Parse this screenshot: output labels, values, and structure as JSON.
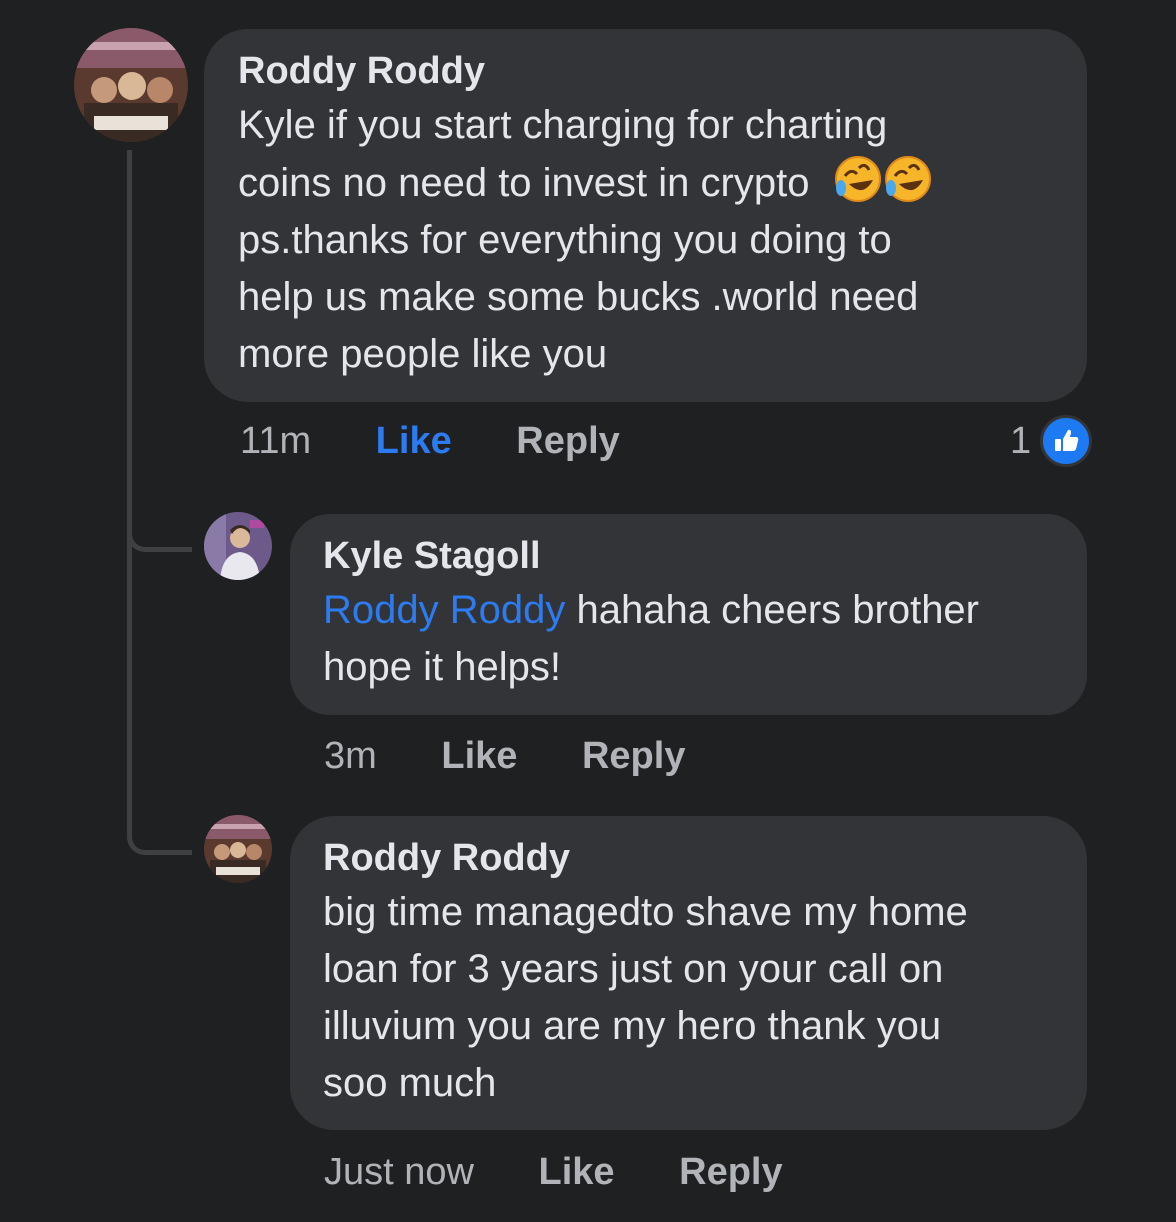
{
  "comments": [
    {
      "author": "Roddy Roddy",
      "text_lines": [
        "Kyle if you start charging for charting",
        "coins no need to invest in crypto",
        "ps.thanks for everything you doing to",
        "help us make some bucks .world need",
        "more people like you"
      ],
      "emoji": [
        "rolling-on-floor-laughing-emoji",
        "rolling-on-floor-laughing-emoji"
      ],
      "time": "11m",
      "like_label": "Like",
      "reply_label": "Reply",
      "reaction_count": "1",
      "reaction_icon": "thumbs-up-icon"
    },
    {
      "author": "Kyle Stagoll",
      "mention": "Roddy Roddy",
      "text_line1": "hahaha cheers brother",
      "text_line2": "hope it helps!",
      "time": "3m",
      "like_label": "Like",
      "reply_label": "Reply"
    },
    {
      "author": "Roddy Roddy",
      "text_lines": [
        "big time managedto shave my home",
        "loan for 3 years just on your call on",
        "illuvium you are my hero thank you",
        "soo much"
      ],
      "time": "Just now",
      "like_label": "Like",
      "reply_label": "Reply"
    }
  ],
  "colors": {
    "background": "#1f2022",
    "bubble": "#333438",
    "accent": "#2d7bf0",
    "muted": "#b0b3b8"
  }
}
